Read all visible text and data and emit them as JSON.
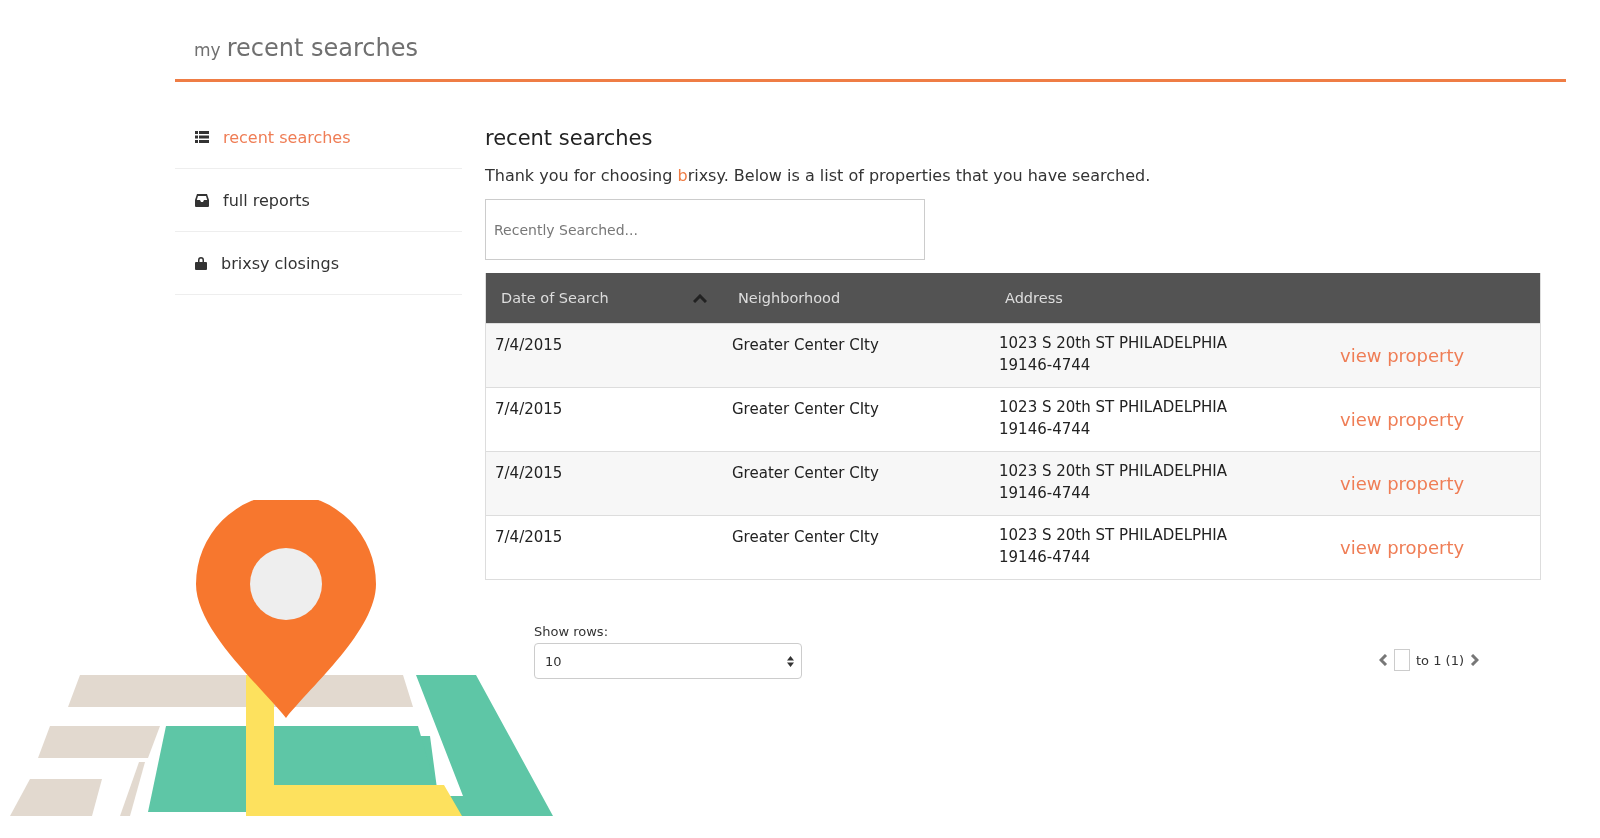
{
  "header": {
    "prefix": "my",
    "title": "recent searches"
  },
  "sidebar": {
    "items": [
      {
        "label": "recent searches",
        "selected": true
      },
      {
        "label": "full reports",
        "selected": false
      },
      {
        "label": "brixsy closings",
        "selected": false
      }
    ]
  },
  "main": {
    "heading": "recent searches",
    "description": [
      {
        "text": "Thank you for choosing ",
        "highlight": false
      },
      {
        "text": "b",
        "highlight": true
      },
      {
        "text": "rixsy. Below is a list of properties that you have searched.",
        "highlight": false
      }
    ],
    "search": {
      "placeholder": "Recently Searched..."
    }
  },
  "table": {
    "columns": [
      {
        "label": "Date of Search",
        "sorted": true
      },
      {
        "label": "Neighborhood",
        "sorted": false
      },
      {
        "label": "Address",
        "sorted": false
      }
    ],
    "rows": [
      {
        "date": "7/4/2015",
        "neighborhood": "Greater Center CIty",
        "address": "1023 S 20th ST PHILADELPHIA 19146-4744",
        "link": "view property"
      },
      {
        "date": "7/4/2015",
        "neighborhood": "Greater Center CIty",
        "address": "1023 S 20th ST PHILADELPHIA 19146-4744",
        "link": "view property"
      },
      {
        "date": "7/4/2015",
        "neighborhood": "Greater Center CIty",
        "address": "1023 S 20th ST PHILADELPHIA 19146-4744",
        "link": "view property"
      },
      {
        "date": "7/4/2015",
        "neighborhood": "Greater Center CIty",
        "address": "1023 S 20th ST PHILADELPHIA 19146-4744",
        "link": "view property"
      }
    ]
  },
  "footer": {
    "rows_label": "Show rows:",
    "rows_value": "10",
    "pager_text": "to 1 (1)"
  }
}
